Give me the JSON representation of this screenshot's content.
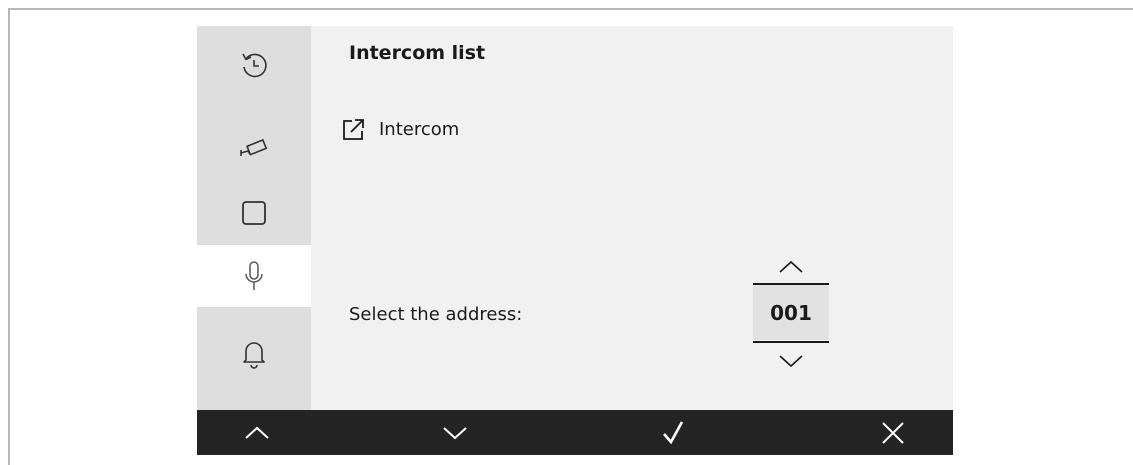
{
  "sidebar": {
    "items": [
      {
        "icon": "history-icon",
        "active": false
      },
      {
        "icon": "camera-icon",
        "active": false
      },
      {
        "icon": "square-icon",
        "active": false
      },
      {
        "icon": "microphone-icon",
        "active": true
      },
      {
        "icon": "bell-icon",
        "active": false
      }
    ]
  },
  "main": {
    "title": "Intercom list",
    "link_label": "Intercom",
    "link_icon": "external-link-icon",
    "address_label": "Select the address:",
    "address_value": "001"
  },
  "bottom_bar": {
    "buttons": [
      {
        "icon": "chevron-up-icon"
      },
      {
        "icon": "chevron-down-icon"
      },
      {
        "icon": "checkmark-icon"
      },
      {
        "icon": "close-icon"
      }
    ]
  },
  "colors": {
    "sidebar_bg": "#dedede",
    "content_bg": "#f1f1f1",
    "bottom_bar_bg": "#242424",
    "active_item_bg": "#ffffff"
  }
}
